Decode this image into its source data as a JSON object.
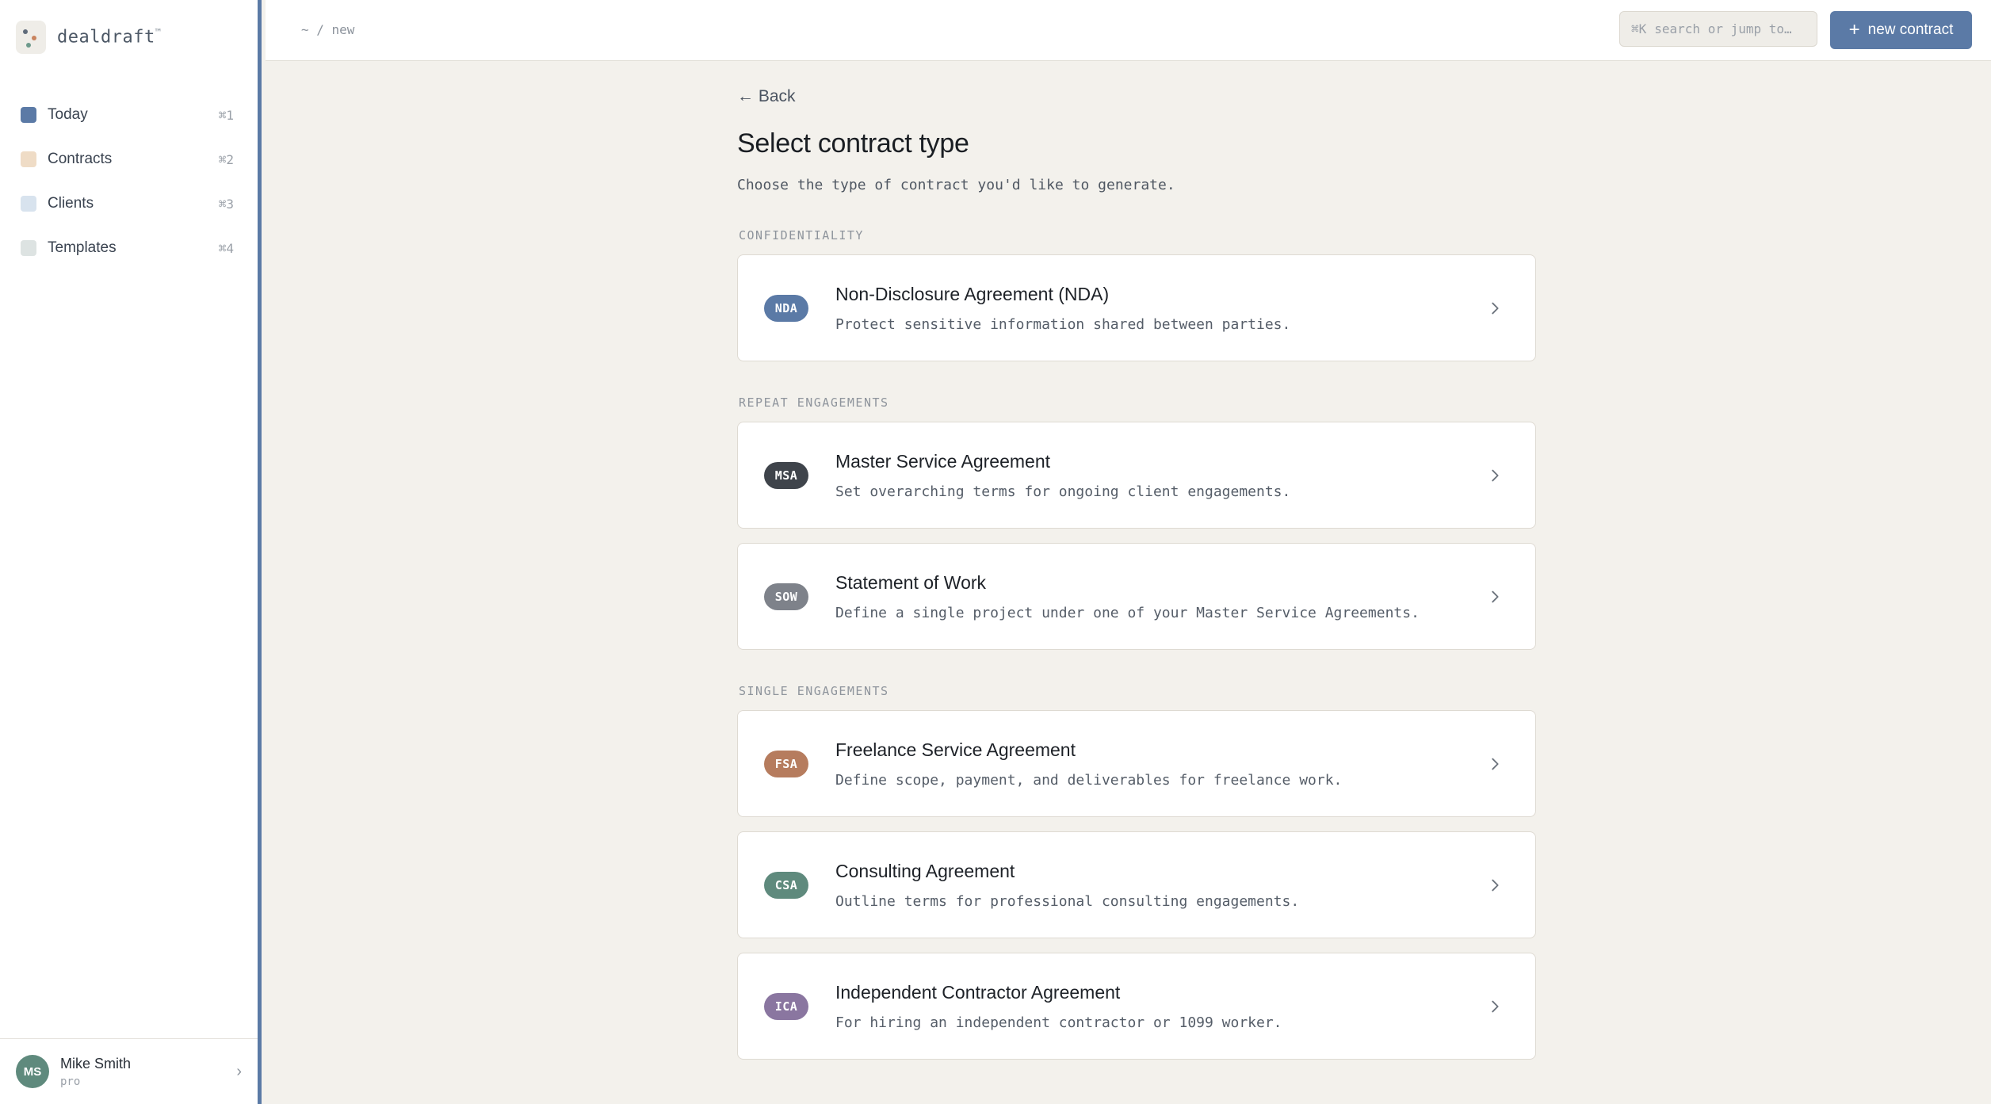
{
  "brand": {
    "name": "dealdraft",
    "mark": "™"
  },
  "sidebar": {
    "items": [
      {
        "label": "Today",
        "shortcut": "⌘1",
        "color": "#5b7aa6"
      },
      {
        "label": "Contracts",
        "shortcut": "⌘2",
        "color": "#efdcc6"
      },
      {
        "label": "Clients",
        "shortcut": "⌘3",
        "color": "#d8e3ee"
      },
      {
        "label": "Templates",
        "shortcut": "⌘4",
        "color": "#dde3e2"
      }
    ]
  },
  "user": {
    "initials": "MS",
    "name": "Mike Smith",
    "plan": "pro",
    "avatar_color": "#5f8a7d"
  },
  "topbar": {
    "breadcrumb": "~ / new",
    "search_shortcut": "⌘K",
    "search_placeholder": "search or jump to…",
    "new_button_label": "new contract",
    "accent": "#5b7aa6"
  },
  "page": {
    "back_label": "← Back",
    "title": "Select contract type",
    "subtitle": "Choose the type of contract you'd like to generate."
  },
  "sections": [
    {
      "label": "CONFIDENTIALITY",
      "cards": [
        {
          "badge": "NDA",
          "badge_color": "#5b7aa6",
          "title": "Non-Disclosure Agreement (NDA)",
          "desc": "Protect sensitive information shared between parties."
        }
      ]
    },
    {
      "label": "REPEAT ENGAGEMENTS",
      "cards": [
        {
          "badge": "MSA",
          "badge_color": "#3f444b",
          "title": "Master Service Agreement",
          "desc": "Set overarching terms for ongoing client engagements."
        },
        {
          "badge": "SOW",
          "badge_color": "#7e828a",
          "title": "Statement of Work",
          "desc": "Define a single project under one of your Master Service Agreements."
        }
      ]
    },
    {
      "label": "SINGLE ENGAGEMENTS",
      "cards": [
        {
          "badge": "FSA",
          "badge_color": "#b67c5e",
          "title": "Freelance Service Agreement",
          "desc": "Define scope, payment, and deliverables for freelance work."
        },
        {
          "badge": "CSA",
          "badge_color": "#5f8a7d",
          "title": "Consulting Agreement",
          "desc": "Outline terms for professional consulting engagements."
        },
        {
          "badge": "ICA",
          "badge_color": "#8a76a0",
          "title": "Independent Contractor Agreement",
          "desc": "For hiring an independent contractor or 1099 worker."
        }
      ]
    }
  ]
}
